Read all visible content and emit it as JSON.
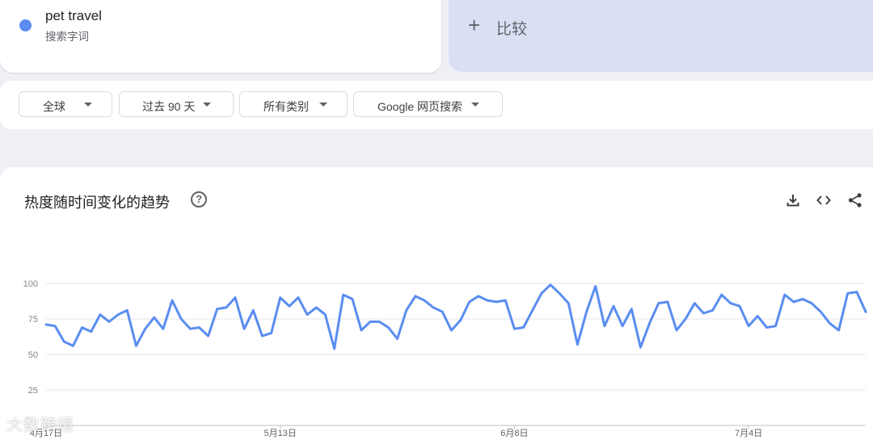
{
  "search_term": {
    "name": "pet travel",
    "type": "搜索字词",
    "color": "#5a8df0"
  },
  "compare": {
    "icon": "plus-icon",
    "label": "比较"
  },
  "filters": [
    {
      "label": "全球"
    },
    {
      "label": "过去 90 天"
    },
    {
      "label": "所有类别"
    },
    {
      "label": "Google 网页搜索"
    }
  ],
  "chart_card": {
    "title": "热度随时间变化的趋势",
    "help_icon": "?",
    "tools": [
      "download-icon",
      "embed-code-icon",
      "share-icon"
    ]
  },
  "chart_data": {
    "type": "line",
    "series": [
      {
        "name": "pet travel",
        "color": "#5a8df0",
        "values": [
          71,
          70,
          59,
          56,
          69,
          66,
          78,
          73,
          78,
          81,
          56,
          68,
          76,
          68,
          88,
          75,
          68,
          69,
          63,
          82,
          83,
          90,
          68,
          81,
          63,
          65,
          90,
          84,
          90,
          78,
          83,
          78,
          54,
          92,
          89,
          67,
          73,
          73,
          69,
          61,
          81,
          91,
          88,
          83,
          80,
          67,
          74,
          87,
          91,
          88,
          87,
          88,
          68,
          69,
          81,
          93,
          99,
          93,
          86,
          57,
          80,
          98,
          70,
          84,
          70,
          82,
          55,
          72,
          86,
          87,
          67,
          75,
          86,
          79,
          81,
          92,
          86,
          84,
          70,
          77,
          69,
          70,
          92,
          87,
          89,
          86,
          80,
          72,
          67,
          93,
          94,
          80
        ]
      }
    ],
    "x_tick_labels": [
      "4月17日",
      "5月13日",
      "6月8日",
      "7月4日"
    ],
    "y_tick_labels": [
      "100",
      "75",
      "50",
      "25"
    ],
    "ylim": [
      0,
      100
    ],
    "grid": true
  },
  "watermark": "大数跨境"
}
